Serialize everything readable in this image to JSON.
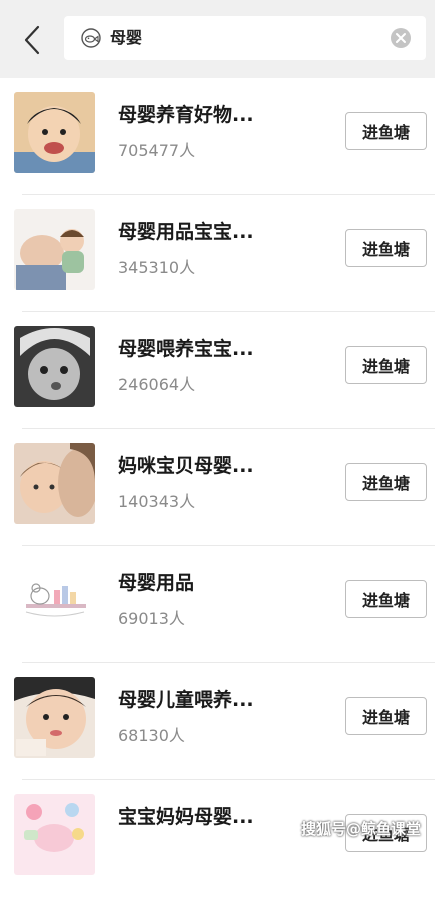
{
  "search": {
    "query": "母婴"
  },
  "groups": [
    {
      "name": "母婴养育好物...",
      "count": "705477人",
      "button": "进鱼塘"
    },
    {
      "name": "母婴用品宝宝...",
      "count": "345310人",
      "button": "进鱼塘"
    },
    {
      "name": "母婴喂养宝宝...",
      "count": "246064人",
      "button": "进鱼塘"
    },
    {
      "name": "妈咪宝贝母婴...",
      "count": "140343人",
      "button": "进鱼塘"
    },
    {
      "name": "母婴用品",
      "count": "69013人",
      "button": "进鱼塘"
    },
    {
      "name": "母婴儿童喂养...",
      "count": "68130人",
      "button": "进鱼塘"
    },
    {
      "name": "宝宝妈妈母婴...",
      "count": "",
      "button": "进鱼塘"
    }
  ],
  "watermark": "搜狐号@鲸鱼课堂",
  "colors": {
    "header_bg": "#f0f0f0",
    "count_text": "#8a8a8a",
    "button_border": "#bdbdbd"
  }
}
